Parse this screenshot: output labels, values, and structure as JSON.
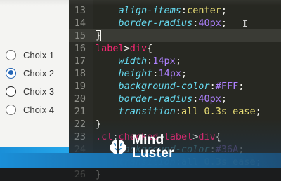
{
  "preview": {
    "radios": [
      {
        "label": "Choix 1",
        "state": "unchecked"
      },
      {
        "label": "Choix 2",
        "state": "checked"
      },
      {
        "label": "Choix 3",
        "state": "hover"
      },
      {
        "label": "Choix 4",
        "state": "unchecked"
      }
    ]
  },
  "editor": {
    "lines": [
      {
        "n": "13",
        "indent": "    ",
        "tokens": [
          [
            "prop",
            "align-items"
          ],
          [
            "punct",
            ":"
          ],
          [
            "str",
            "center"
          ],
          [
            "punct",
            ";"
          ]
        ]
      },
      {
        "n": "14",
        "indent": "    ",
        "tokens": [
          [
            "prop",
            "border-radius"
          ],
          [
            "punct",
            ":"
          ],
          [
            "val",
            "40px"
          ],
          [
            "punct",
            ";"
          ]
        ]
      },
      {
        "n": "15",
        "indent": "",
        "tokens": [
          [
            "brace",
            "}"
          ]
        ],
        "current": true
      },
      {
        "n": "16",
        "indent": "",
        "tokens": [
          [
            "sel",
            "label"
          ],
          [
            "punct",
            ">"
          ],
          [
            "sel",
            "div"
          ],
          [
            "punct",
            "{"
          ]
        ]
      },
      {
        "n": "17",
        "indent": "    ",
        "tokens": [
          [
            "prop",
            "width"
          ],
          [
            "punct",
            ":"
          ],
          [
            "val",
            "14px"
          ],
          [
            "punct",
            ";"
          ]
        ]
      },
      {
        "n": "18",
        "indent": "    ",
        "tokens": [
          [
            "prop",
            "height"
          ],
          [
            "punct",
            ":"
          ],
          [
            "val",
            "14px"
          ],
          [
            "punct",
            ";"
          ]
        ]
      },
      {
        "n": "19",
        "indent": "    ",
        "tokens": [
          [
            "prop",
            "background-color"
          ],
          [
            "punct",
            ":"
          ],
          [
            "val",
            "#FFF"
          ],
          [
            "punct",
            ";"
          ]
        ]
      },
      {
        "n": "20",
        "indent": "    ",
        "tokens": [
          [
            "prop",
            "border-radius"
          ],
          [
            "punct",
            ":"
          ],
          [
            "val",
            "40px"
          ],
          [
            "punct",
            ";"
          ]
        ]
      },
      {
        "n": "21",
        "indent": "    ",
        "tokens": [
          [
            "prop",
            "transition"
          ],
          [
            "punct",
            ":"
          ],
          [
            "str",
            "all 0.3s ease"
          ],
          [
            "punct",
            ";"
          ]
        ]
      },
      {
        "n": "22",
        "indent": "",
        "tokens": [
          [
            "brace",
            "}"
          ]
        ]
      },
      {
        "n": "23",
        "indent": "",
        "tokens": [
          [
            "sel",
            ".cl"
          ],
          [
            "punct",
            ":"
          ],
          [
            "sel",
            "checked"
          ],
          [
            "punct",
            "+"
          ],
          [
            "sel",
            "label"
          ],
          [
            "punct",
            ">"
          ],
          [
            "sel",
            "div"
          ],
          [
            "punct",
            "{"
          ]
        ]
      },
      {
        "n": "24",
        "indent": "    ",
        "tokens": [
          [
            "prop",
            "background-color"
          ],
          [
            "punct",
            ":"
          ],
          [
            "val",
            "#36A"
          ],
          [
            "punct",
            ";"
          ]
        ]
      },
      {
        "n": "25",
        "indent": "    ",
        "tokens": [
          [
            "prop",
            "transition"
          ],
          [
            "punct",
            ":"
          ],
          [
            "str",
            "all 0.3s ease"
          ],
          [
            "punct",
            ";"
          ]
        ]
      },
      {
        "n": "26",
        "indent": "",
        "tokens": [
          [
            "brace",
            "}"
          ]
        ]
      }
    ],
    "cursor_glyph": "I"
  },
  "watermark": {
    "line1": "Mind",
    "line2": "Luster"
  },
  "colors": {
    "editor_bg": "#272822",
    "accent_blue": "#1a8fd8",
    "radio_checked": "#2467b8"
  }
}
